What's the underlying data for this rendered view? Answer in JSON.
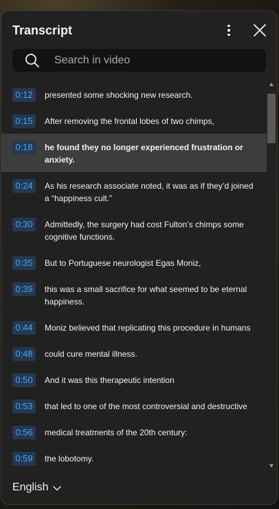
{
  "panel": {
    "title": "Transcript"
  },
  "search": {
    "placeholder": "Search in video"
  },
  "segments": [
    {
      "time": "0:12",
      "text": "presented some shocking new research."
    },
    {
      "time": "0:15",
      "text": "After removing the frontal lobes of two chimps,"
    },
    {
      "time": "0:18",
      "text": "he found they no longer experienced frustration or anxiety."
    },
    {
      "time": "0:24",
      "text": "As his research associate noted, it was as if they’d joined a “happiness cult.”"
    },
    {
      "time": "0:30",
      "text": "Admittedly, the surgery had cost Fulton’s chimps some cognitive functions."
    },
    {
      "time": "0:35",
      "text": "But to Portuguese neurologist Egas Moniz,"
    },
    {
      "time": "0:39",
      "text": "this was a small sacrifice for what seemed to be eternal happiness."
    },
    {
      "time": "0:44",
      "text": "Moniz believed that replicating this procedure in humans"
    },
    {
      "time": "0:48",
      "text": "could cure mental illness."
    },
    {
      "time": "0:50",
      "text": "And it was this therapeutic intention"
    },
    {
      "time": "0:53",
      "text": "that led to one of the most controversial and destructive"
    },
    {
      "time": "0:56",
      "text": "medical treatments of the 20th century:"
    },
    {
      "time": "0:59",
      "text": "the lobotomy."
    }
  ],
  "active_segment": "0:18",
  "footer": {
    "language": "English"
  },
  "icons": {
    "more": "more-vert-icon",
    "close": "close-icon",
    "search": "search-icon",
    "language_dropdown": "chevron-down-icon"
  },
  "colors": {
    "panel_bg": "#212121",
    "timestamp_text": "#3ea6ff",
    "timestamp_bg": "#263850",
    "active_row_bg": "#3d3d3d"
  }
}
